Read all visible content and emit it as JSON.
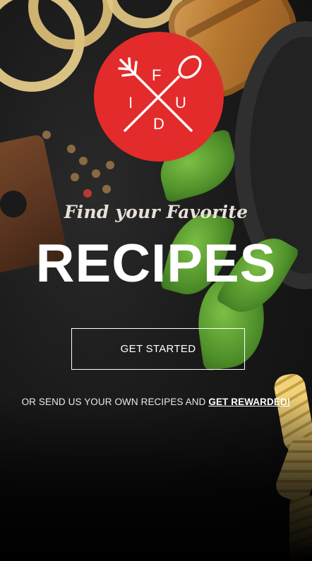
{
  "logo": {
    "letters": {
      "top": "F",
      "left": "I",
      "right": "U",
      "bottom": "D"
    },
    "icons": [
      "fork-icon",
      "spoon-icon"
    ],
    "color": "#e32b2b"
  },
  "hero": {
    "tagline": "Find your Favorite",
    "headline": "RECIPES"
  },
  "cta": {
    "label": "GET STARTED"
  },
  "footer": {
    "text": "OR SEND US YOUR OWN RECIPES AND",
    "link_label": "GET REWARDED!"
  }
}
